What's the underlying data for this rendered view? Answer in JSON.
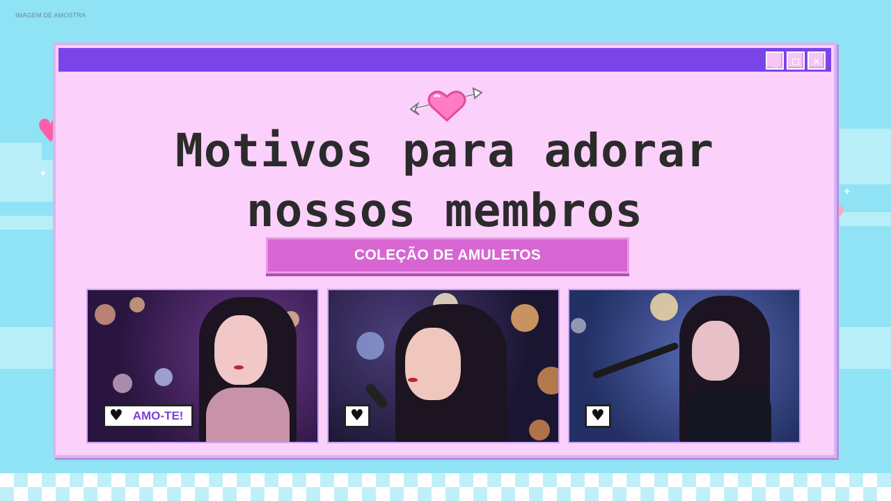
{
  "watermark": "IMAGEM DE AMOSTRA",
  "window": {
    "buttons": {
      "minimize": "_",
      "maximize": "□",
      "close": "✕"
    }
  },
  "title_line1": "Motivos para adorar",
  "title_line2": "nossos membros",
  "subtitle": "COLEÇÃO DE AMULETOS",
  "cards": [
    {
      "badge_text": "AMO-TE!",
      "icon": "heart-icon"
    },
    {
      "badge_text": "",
      "icon": "heart-icon"
    },
    {
      "badge_text": "",
      "icon": "heart-icon"
    }
  ],
  "decor_icons": [
    "heart-arrow-icon",
    "pixel-heart-icon",
    "sparkle-icon"
  ],
  "colors": {
    "background": "#8fe3f5",
    "window": "#fbd0fb",
    "titlebar": "#7a45e8",
    "button": "#d766d3",
    "badge_text": "#7b3fe0"
  }
}
